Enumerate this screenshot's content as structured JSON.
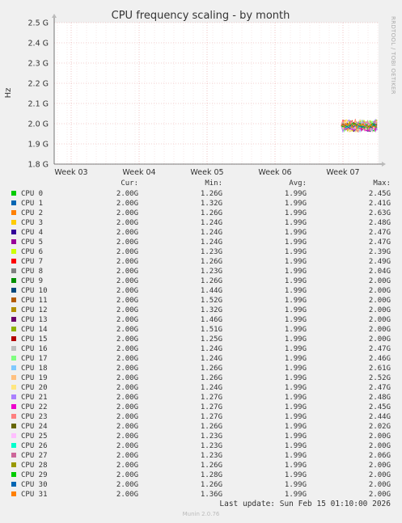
{
  "chart_data": {
    "type": "line",
    "title": "CPU frequency scaling - by month",
    "ylabel": "Hz",
    "side_label": "RRDTOOL / TOBI OETIKER",
    "y_ticks": [
      "2.5 G",
      "2.4 G",
      "2.3 G",
      "2.2 G",
      "2.1 G",
      "2.0 G",
      "1.9 G",
      "1.8 G"
    ],
    "y_tick_values": [
      2.5,
      2.4,
      2.3,
      2.2,
      2.1,
      2.0,
      1.9,
      1.8
    ],
    "ylim": [
      1.8,
      2.5
    ],
    "x_ticks": [
      "Week 03",
      "Week 04",
      "Week 05",
      "Week 06",
      "Week 07"
    ],
    "grid": true,
    "legend_headers": {
      "cur": "Cur:",
      "min": "Min:",
      "avg": "Avg:",
      "max": "Max:"
    },
    "series": [
      {
        "name": "CPU 0",
        "color": "#00cc00",
        "cur": "2.00G",
        "min": "1.26G",
        "avg": "1.99G",
        "max": "2.45G"
      },
      {
        "name": "CPU 1",
        "color": "#0066b3",
        "cur": "2.00G",
        "min": "1.32G",
        "avg": "1.99G",
        "max": "2.41G"
      },
      {
        "name": "CPU 2",
        "color": "#ff8000",
        "cur": "2.00G",
        "min": "1.26G",
        "avg": "1.99G",
        "max": "2.63G"
      },
      {
        "name": "CPU 3",
        "color": "#ffcc00",
        "cur": "2.00G",
        "min": "1.24G",
        "avg": "1.99G",
        "max": "2.48G"
      },
      {
        "name": "CPU 4",
        "color": "#330099",
        "cur": "2.00G",
        "min": "1.24G",
        "avg": "1.99G",
        "max": "2.47G"
      },
      {
        "name": "CPU 5",
        "color": "#990099",
        "cur": "2.00G",
        "min": "1.24G",
        "avg": "1.99G",
        "max": "2.47G"
      },
      {
        "name": "CPU 6",
        "color": "#ccff00",
        "cur": "2.00G",
        "min": "1.23G",
        "avg": "1.99G",
        "max": "2.39G"
      },
      {
        "name": "CPU 7",
        "color": "#ff0000",
        "cur": "2.00G",
        "min": "1.26G",
        "avg": "1.99G",
        "max": "2.49G"
      },
      {
        "name": "CPU 8",
        "color": "#808080",
        "cur": "2.00G",
        "min": "1.23G",
        "avg": "1.99G",
        "max": "2.04G"
      },
      {
        "name": "CPU 9",
        "color": "#008f00",
        "cur": "2.00G",
        "min": "1.26G",
        "avg": "1.99G",
        "max": "2.00G"
      },
      {
        "name": "CPU 10",
        "color": "#00487d",
        "cur": "2.00G",
        "min": "1.44G",
        "avg": "1.99G",
        "max": "2.00G"
      },
      {
        "name": "CPU 11",
        "color": "#b35a00",
        "cur": "2.00G",
        "min": "1.52G",
        "avg": "1.99G",
        "max": "2.00G"
      },
      {
        "name": "CPU 12",
        "color": "#b38f00",
        "cur": "2.00G",
        "min": "1.32G",
        "avg": "1.99G",
        "max": "2.00G"
      },
      {
        "name": "CPU 13",
        "color": "#6b006b",
        "cur": "2.00G",
        "min": "1.46G",
        "avg": "1.99G",
        "max": "2.00G"
      },
      {
        "name": "CPU 14",
        "color": "#8fb300",
        "cur": "2.00G",
        "min": "1.51G",
        "avg": "1.99G",
        "max": "2.00G"
      },
      {
        "name": "CPU 15",
        "color": "#b30000",
        "cur": "2.00G",
        "min": "1.25G",
        "avg": "1.99G",
        "max": "2.00G"
      },
      {
        "name": "CPU 16",
        "color": "#bebebe",
        "cur": "2.00G",
        "min": "1.24G",
        "avg": "1.99G",
        "max": "2.47G"
      },
      {
        "name": "CPU 17",
        "color": "#80ff80",
        "cur": "2.00G",
        "min": "1.24G",
        "avg": "1.99G",
        "max": "2.46G"
      },
      {
        "name": "CPU 18",
        "color": "#80c9ff",
        "cur": "2.00G",
        "min": "1.26G",
        "avg": "1.99G",
        "max": "2.61G"
      },
      {
        "name": "CPU 19",
        "color": "#ffc080",
        "cur": "2.00G",
        "min": "1.26G",
        "avg": "1.99G",
        "max": "2.52G"
      },
      {
        "name": "CPU 20",
        "color": "#ffe680",
        "cur": "2.00G",
        "min": "1.24G",
        "avg": "1.99G",
        "max": "2.47G"
      },
      {
        "name": "CPU 21",
        "color": "#aa80ff",
        "cur": "2.00G",
        "min": "1.27G",
        "avg": "1.99G",
        "max": "2.48G"
      },
      {
        "name": "CPU 22",
        "color": "#ee00cc",
        "cur": "2.00G",
        "min": "1.27G",
        "avg": "1.99G",
        "max": "2.45G"
      },
      {
        "name": "CPU 23",
        "color": "#ff8080",
        "cur": "2.00G",
        "min": "1.27G",
        "avg": "1.99G",
        "max": "2.44G"
      },
      {
        "name": "CPU 24",
        "color": "#666600",
        "cur": "2.00G",
        "min": "1.26G",
        "avg": "1.99G",
        "max": "2.02G"
      },
      {
        "name": "CPU 25",
        "color": "#ffbfff",
        "cur": "2.00G",
        "min": "1.23G",
        "avg": "1.99G",
        "max": "2.00G"
      },
      {
        "name": "CPU 26",
        "color": "#00ffcc",
        "cur": "2.00G",
        "min": "1.23G",
        "avg": "1.99G",
        "max": "2.00G"
      },
      {
        "name": "CPU 27",
        "color": "#cc6699",
        "cur": "2.00G",
        "min": "1.23G",
        "avg": "1.99G",
        "max": "2.06G"
      },
      {
        "name": "CPU 28",
        "color": "#999900",
        "cur": "2.00G",
        "min": "1.26G",
        "avg": "1.99G",
        "max": "2.00G"
      },
      {
        "name": "CPU 29",
        "color": "#00cc00",
        "cur": "2.00G",
        "min": "1.28G",
        "avg": "1.99G",
        "max": "2.00G"
      },
      {
        "name": "CPU 30",
        "color": "#0066b3",
        "cur": "2.00G",
        "min": "1.26G",
        "avg": "1.99G",
        "max": "2.00G"
      },
      {
        "name": "CPU 31",
        "color": "#ff8000",
        "cur": "2.00G",
        "min": "1.36G",
        "avg": "1.99G",
        "max": "2.00G"
      }
    ]
  },
  "last_update": "Last update: Sun Feb 15 01:10:00 2026",
  "footer": "Munin 2.0.76"
}
